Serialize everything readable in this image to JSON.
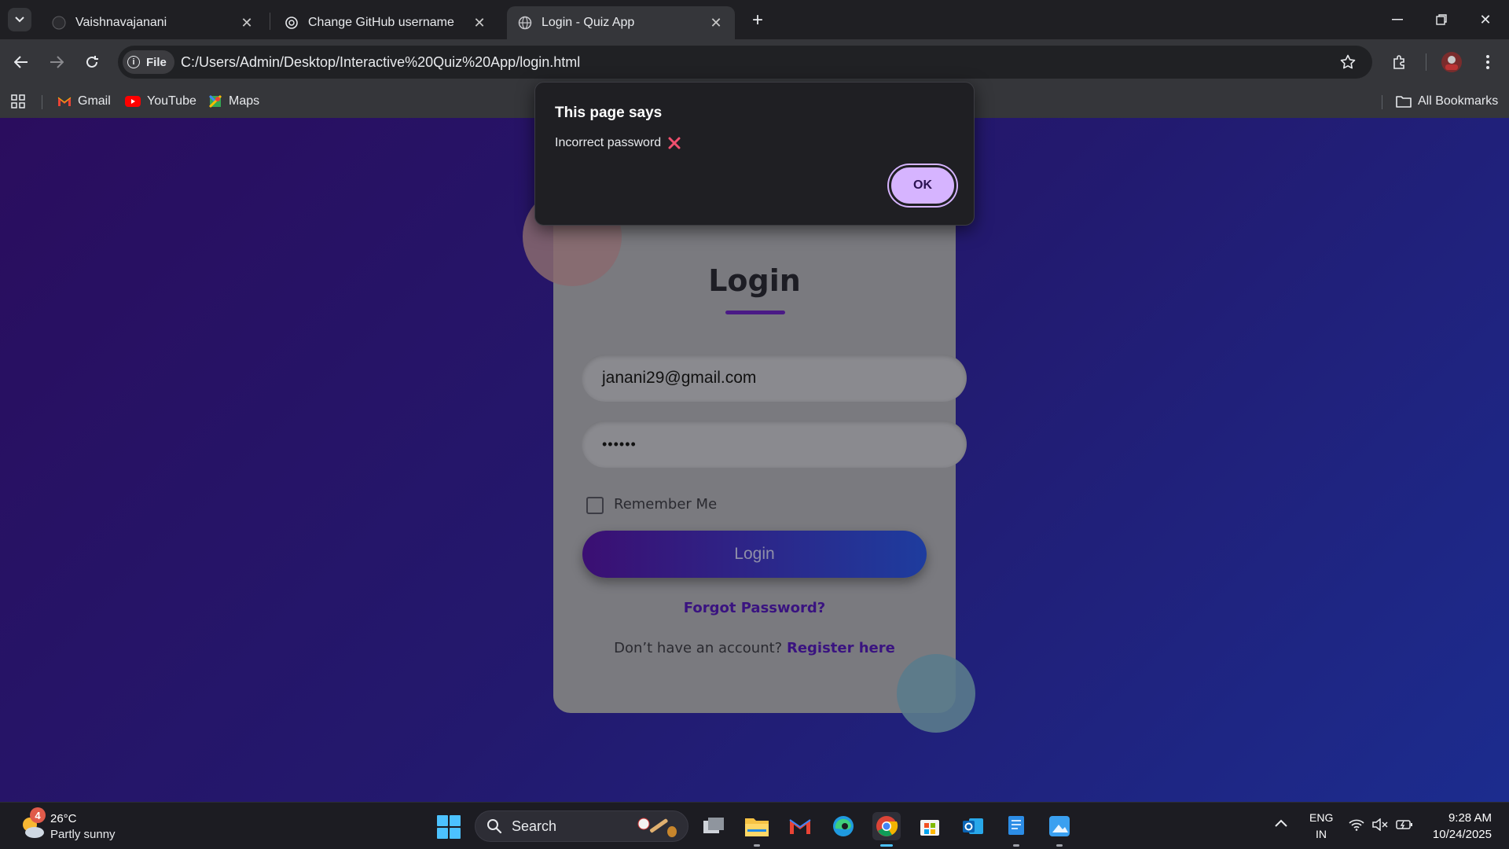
{
  "browser": {
    "tabs": [
      {
        "title": "Vaishnavajanani",
        "favicon": "github-icon",
        "active": false
      },
      {
        "title": "Change GitHub username",
        "favicon": "openai-icon",
        "active": false
      },
      {
        "title": "Login - Quiz App",
        "favicon": "globe-icon",
        "active": true
      }
    ],
    "address": {
      "scheme_chip": "File",
      "url": "C:/Users/Admin/Desktop/Interactive%20Quiz%20App/login.html"
    },
    "bookmarks": [
      {
        "label": "Gmail",
        "icon": "gmail-icon"
      },
      {
        "label": "YouTube",
        "icon": "youtube-icon"
      },
      {
        "label": "Maps",
        "icon": "maps-icon"
      }
    ],
    "all_bookmarks_label": "All Bookmarks"
  },
  "dialog": {
    "title": "This page says",
    "message": "Incorrect password",
    "message_icon": "cross-mark-icon",
    "ok_label": "OK"
  },
  "login": {
    "title": "Login",
    "email_value": "janani29@gmail.com",
    "password_mask": "••••••",
    "remember_label": "Remember Me",
    "remember_checked": false,
    "login_button": "Login",
    "forgot_link": "Forgot Password?",
    "register_prompt": "Don’t have an account?",
    "register_link": "Register here"
  },
  "taskbar": {
    "weather": {
      "badge": "4",
      "temp": "26°C",
      "desc": "Partly sunny"
    },
    "search_label": "Search",
    "language": {
      "line1": "ENG",
      "line2": "IN"
    },
    "clock": {
      "time": "9:28 AM",
      "date": "10/24/2025"
    }
  },
  "colors": {
    "accent_purple": "#3a1380",
    "dialog_button": "#d6b4ff",
    "page_gradient_start": "#2a0d5e",
    "page_gradient_end": "#1c2c8e"
  }
}
